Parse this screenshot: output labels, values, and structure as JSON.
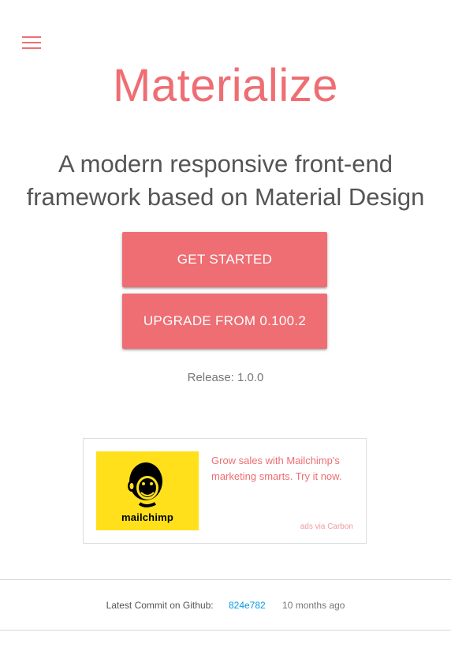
{
  "header": {
    "menu_icon": "hamburger-menu-icon",
    "brand": "Materialize",
    "tagline": "A modern responsive front-end framework based on Material Design"
  },
  "actions": {
    "get_started_label": "GET STARTED",
    "upgrade_label": "UPGRADE FROM 0.100.2"
  },
  "release": {
    "text": "Release: 1.0.0"
  },
  "ad": {
    "image_icon": "mailchimp-logo-icon",
    "image_text": "mailchimp",
    "text": "Grow sales with Mailchimp's marketing smarts. Try it now.",
    "via": "ads via Carbon"
  },
  "footer": {
    "commit_label": "Latest Commit on Github:",
    "commit_sha": "824e782",
    "commit_age": "10 months ago"
  },
  "colors": {
    "accent": "#ee6e73",
    "link": "#039be5",
    "ad_background": "#ffe01b"
  }
}
